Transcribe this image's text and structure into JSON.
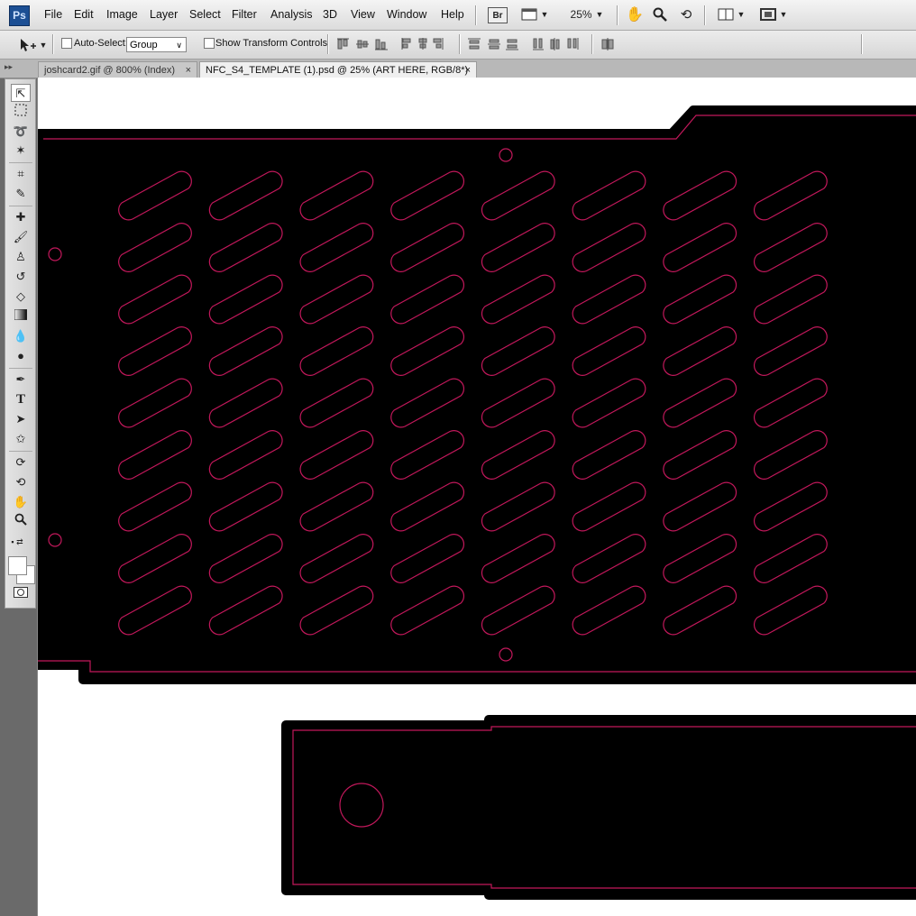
{
  "app": {
    "logo": "Ps"
  },
  "menu": [
    "File",
    "Edit",
    "Image",
    "Layer",
    "Select",
    "Filter",
    "Analysis",
    "3D",
    "View",
    "Window",
    "Help"
  ],
  "menubar_controls": {
    "bridge": "Br",
    "zoom": "25%"
  },
  "options": {
    "auto_select_label": "Auto-Select:",
    "auto_select_value": "Group",
    "show_transform_label": "Show Transform Controls"
  },
  "tabs": [
    {
      "label": "joshcard2.gif @ 800% (Index)",
      "close": "×"
    },
    {
      "label": "NFC_S4_TEMPLATE (1).psd @ 25% (ART HERE, RGB/8*)",
      "close": "×"
    }
  ],
  "template": {
    "outline_color": "#c2185b",
    "fill_color": "#000000",
    "slot_columns": 8,
    "slot_rows": 9
  }
}
